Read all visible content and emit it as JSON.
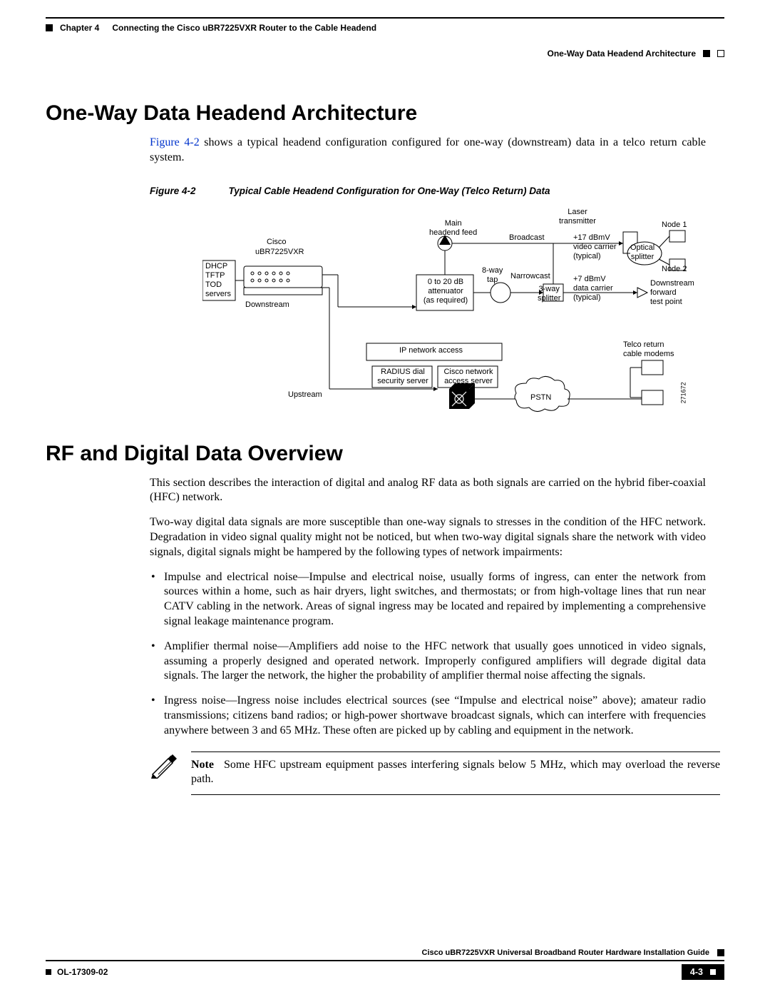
{
  "header": {
    "chapter": "Chapter 4",
    "chapter_title": "Connecting the Cisco uBR7225VXR Router to the Cable Headend",
    "section_right": "One-Way Data Headend Architecture"
  },
  "section1": {
    "title": "One-Way Data Headend Architecture",
    "para1_pre": " shows a typical headend configuration configured for one-way (downstream) data in a telco return cable system.",
    "figref": "Figure 4-2",
    "figure_caption_num": "Figure 4-2",
    "figure_caption_text": "Typical Cable Headend Configuration for One-Way (Telco Return) Data"
  },
  "diagram": {
    "cisco": "Cisco",
    "model": "uBR7225VXR",
    "servers": "DHCP\nTFTP\nTOD\nservers",
    "downstream": "Downstream",
    "upstream": "Upstream",
    "main_feed": "Main\nheadend feed",
    "attenuator": "0 to 20 dB\nattenuator\n(as required)",
    "tap": "8-way\ntap",
    "narrowcast": "Narrowcast",
    "splitter3": "3-way\nsplitter",
    "broadcast": "Broadcast",
    "laser": "Laser\ntransmitter",
    "video_carrier": "+17 dBmV\nvideo carrier\n(typical)",
    "data_carrier": "+7 dBmV\ndata carrier\n(typical)",
    "optical_splitter": "Optical\nsplitter",
    "node1": "Node 1",
    "node2": "Node 2",
    "fwd_test": "Downstream\nforward\ntest point",
    "ip_access": "IP network access",
    "radius": "RADIUS dial\nsecurity server",
    "cisco_access": "Cisco network\naccess server",
    "pstn": "PSTN",
    "telco_modems": "Telco return\ncable modems",
    "fig_id": "271672"
  },
  "section2": {
    "title": "RF and Digital Data Overview",
    "para1": "This section describes the interaction of digital and analog RF data as both signals are carried on the hybrid fiber-coaxial (HFC) network.",
    "para2": "Two-way digital data signals are more susceptible than one-way signals to stresses in the condition of the HFC network. Degradation in video signal quality might not be noticed, but when two-way digital signals share the network with video signals, digital signals might be hampered by the following types of network impairments:",
    "bullets": [
      "Impulse and electrical noise—Impulse and electrical noise, usually forms of ingress, can enter the network from sources within a home, such as hair dryers, light switches, and thermostats; or from high-voltage lines that run near CATV cabling in the network. Areas of signal ingress may be located and repaired by implementing a comprehensive signal leakage maintenance program.",
      "Amplifier thermal noise—Amplifiers add noise to the HFC network that usually goes unnoticed in video signals, assuming a properly designed and operated network. Improperly configured amplifiers will degrade digital data signals. The larger the network, the higher the probability of amplifier thermal noise affecting the signals.",
      "Ingress noise—Ingress noise includes electrical sources (see “Impulse and electrical noise” above); amateur radio transmissions; citizens band radios; or high-power shortwave broadcast signals, which can interfere with frequencies anywhere between 3 and 65 MHz. These often are picked up by cabling and equipment in the network."
    ],
    "note_label": "Note",
    "note_text": "Some HFC upstream equipment passes interfering signals below 5 MHz, which may overload the reverse path."
  },
  "footer": {
    "book": "Cisco uBR7225VXR Universal Broadband Router Hardware Installation Guide",
    "docid": "OL-17309-02",
    "page": "4-3"
  }
}
